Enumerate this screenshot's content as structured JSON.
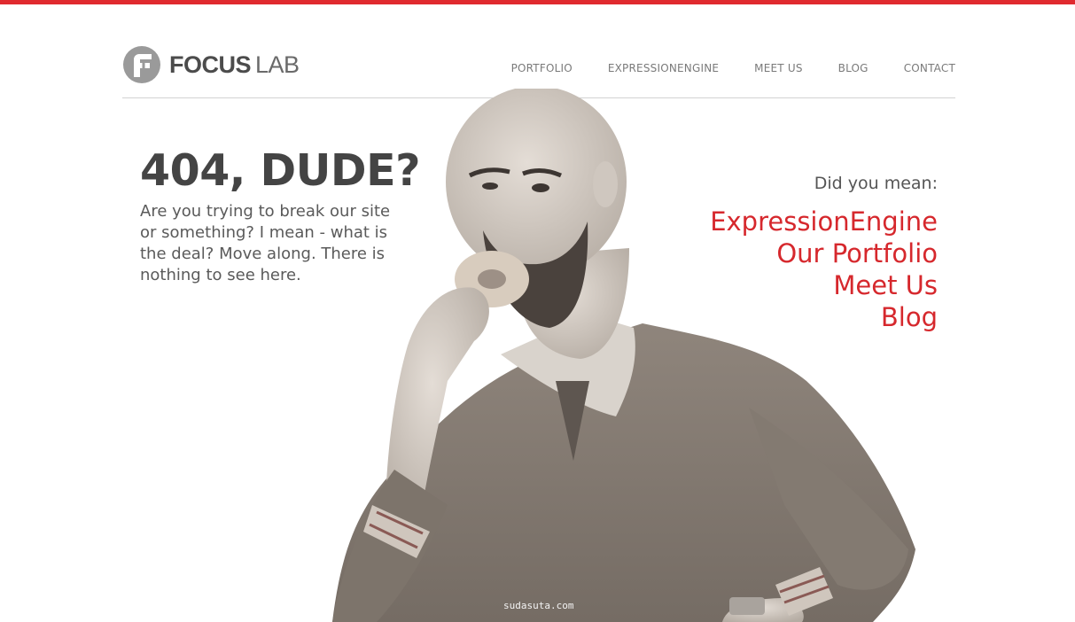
{
  "brand": {
    "bold": "FOCUS",
    "light": "LAB"
  },
  "nav": {
    "items": [
      {
        "label": "PORTFOLIO"
      },
      {
        "label": "EXPRESSIONENGINE"
      },
      {
        "label": "MEET US"
      },
      {
        "label": "BLOG"
      },
      {
        "label": "CONTACT"
      }
    ]
  },
  "error": {
    "headline": "404, DUDE?",
    "message": "Are you trying to break our site or something? I mean - what is the deal? Move along. There is nothing to see here."
  },
  "suggest": {
    "label": "Did you mean:",
    "links": [
      {
        "label": "ExpressionEngine"
      },
      {
        "label": "Our Portfolio"
      },
      {
        "label": "Meet Us"
      },
      {
        "label": "Blog"
      }
    ]
  },
  "watermark": "sudasuta.com",
  "colors": {
    "accent": "#e02a2f",
    "link": "#d6282d",
    "text": "#444444",
    "logo_gray": "#9a9a9a"
  },
  "icons": {
    "logo": "focus-lab-logo-mark"
  }
}
